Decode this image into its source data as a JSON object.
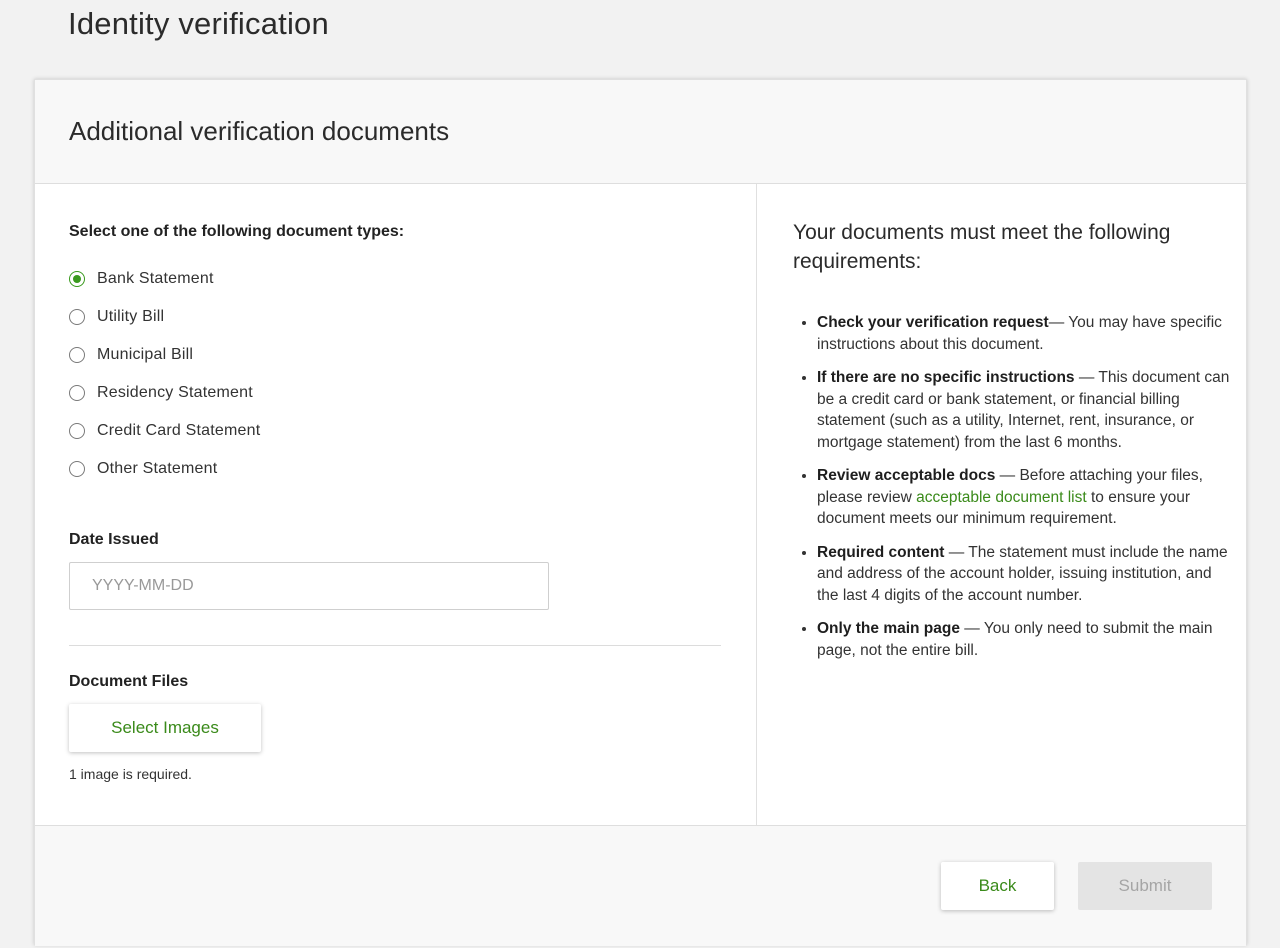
{
  "page": {
    "title": "Identity verification"
  },
  "card": {
    "title": "Additional verification documents"
  },
  "document_types": {
    "label": "Select one of the following document types:",
    "selected": "Bank Statement",
    "options": [
      "Bank Statement",
      "Utility Bill",
      "Municipal Bill",
      "Residency Statement",
      "Credit Card Statement",
      "Other Statement"
    ]
  },
  "date_issued": {
    "label": "Date Issued",
    "placeholder": "YYYY-MM-DD",
    "value": ""
  },
  "document_files": {
    "label": "Document Files",
    "button_label": "Select Images",
    "hint": "1 image is required."
  },
  "requirements": {
    "title": "Your documents must meet the following requirements:",
    "items": [
      {
        "heading": "Check your verification request",
        "text": "— You may have specific instructions about this document."
      },
      {
        "heading": "If there are no specific instructions",
        "text": " — This document can be a credit card or bank statement, or financial billing statement (such as a utility, Internet, rent, insurance, or mortgage statement) from the last 6 months."
      },
      {
        "heading": "Review acceptable docs",
        "text_before_link": " — Before attaching your files, please review ",
        "link_text": "acceptable document list",
        "text_after_link": " to ensure your document meets our minimum requirement."
      },
      {
        "heading": "Required content",
        "text": " — The statement must include the name and address of the account holder, issuing institution, and the last 4 digits of the account number."
      },
      {
        "heading": "Only the main page",
        "text": " — You only need to submit the main page, not the entire bill."
      }
    ]
  },
  "footer": {
    "back_label": "Back",
    "submit_label": "Submit",
    "submit_enabled": false
  },
  "colors": {
    "accent": "#3a8a1a",
    "radio_checked": "#3a9a1e",
    "disabled_bg": "#e4e4e4",
    "disabled_text": "#a5a5a5"
  }
}
